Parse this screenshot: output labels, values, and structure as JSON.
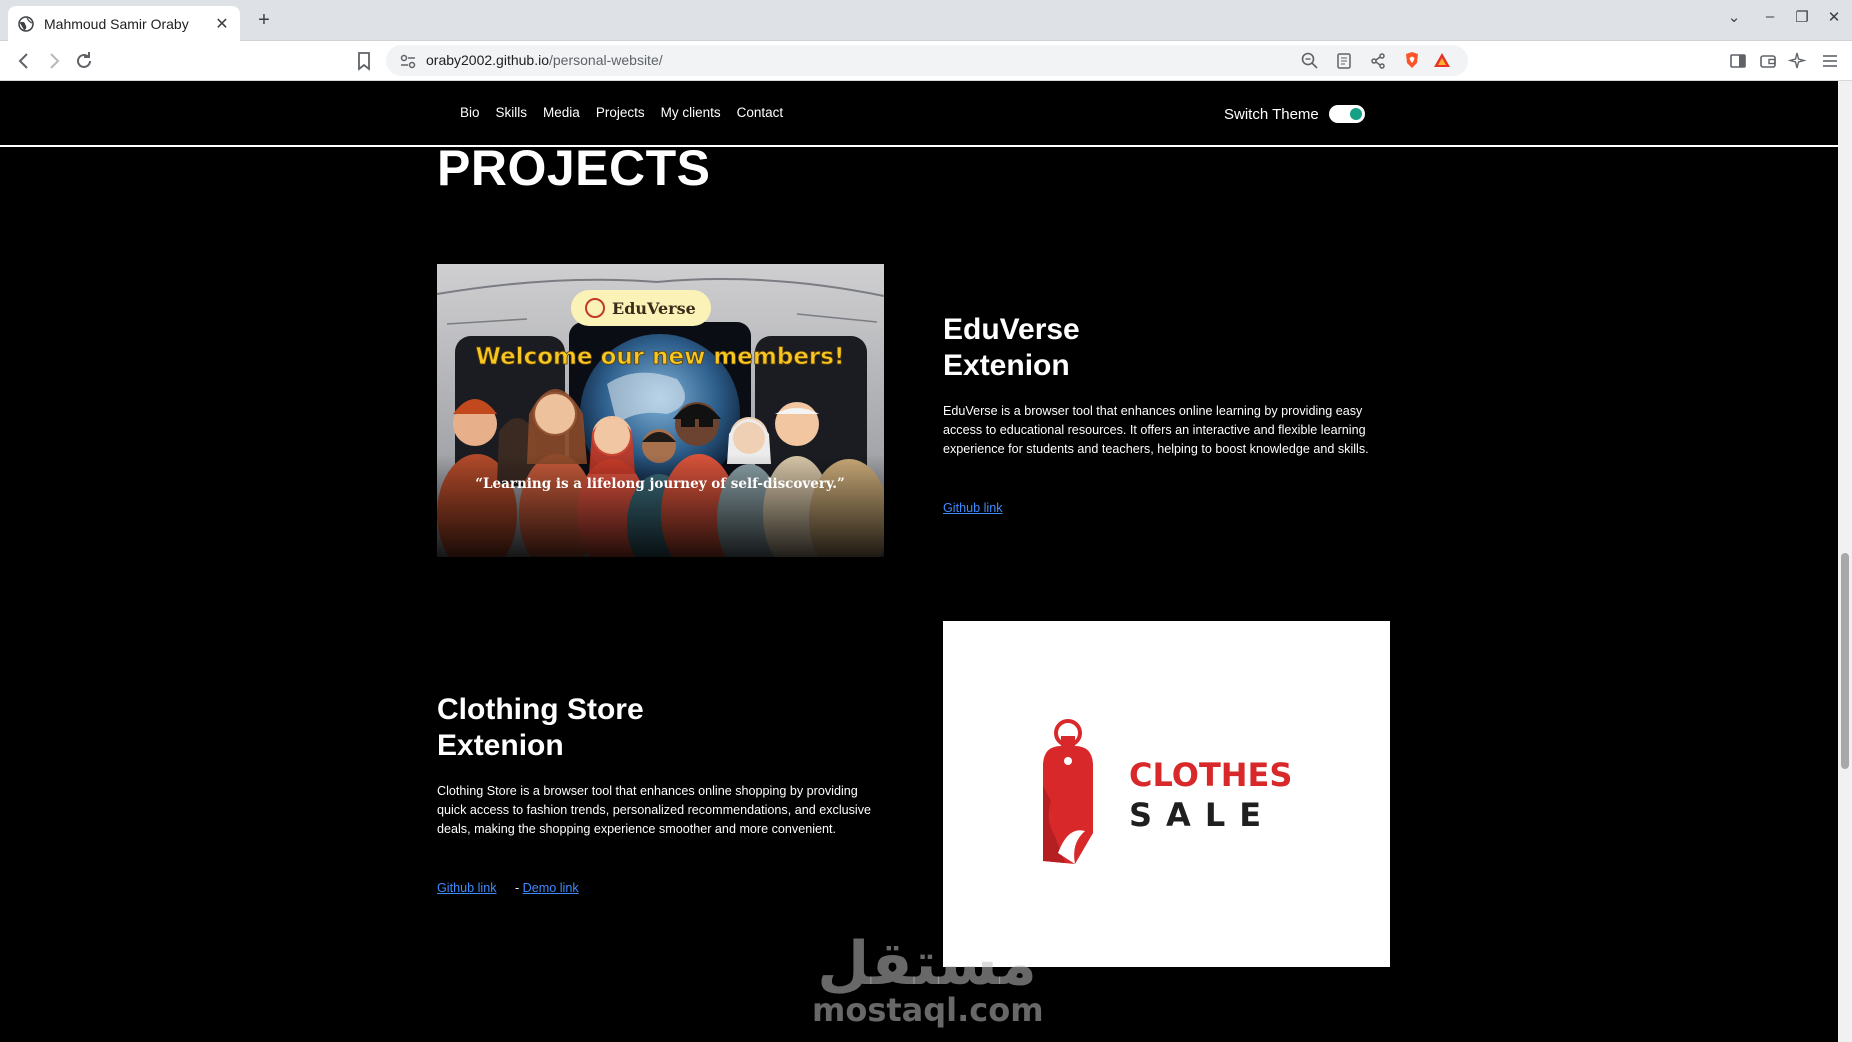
{
  "browser": {
    "tab_title": "Mahmoud Samir Oraby",
    "url_host": "oraby2002.github.io",
    "url_path": "/personal-website/"
  },
  "site": {
    "nav": [
      "Bio",
      "Skills",
      "Media",
      "Projects",
      "My clients",
      "Contact"
    ],
    "theme_label": "Switch Theme",
    "theme_on": true
  },
  "projects": {
    "heading": "PROJECTS",
    "items": [
      {
        "title_line1": "EduVerse",
        "title_line2": "Extenion",
        "description": "EduVerse is a browser tool that enhances online learning by providing easy access to educational resources. It offers an interactive and flexible learning experience for students and teachers, helping to boost knowledge and skills.",
        "github_label": "Github link ",
        "image": {
          "badge": "EduVerse",
          "banner": "Welcome our new members!",
          "quote": "“Learning is a lifelong journey of self-discovery.”"
        }
      },
      {
        "title_line1": "Clothing Store",
        "title_line2": "Extenion",
        "description": "Clothing Store is a browser tool that enhances online shopping by providing quick access to fashion trends, personalized recommendations, and exclusive deals, making the shopping experience smoother and more convenient.",
        "github_label": "Github link",
        "separator": "- ",
        "demo_label": "Demo link",
        "image": {
          "word1": "CLOTHES",
          "word2": "SALE"
        }
      }
    ]
  },
  "watermark": {
    "arabic": "مستقل",
    "latin": "mostaql.com"
  },
  "colors": {
    "accent_toggle": "#16a085",
    "link": "#3d8bfd",
    "brand_red": "#d8282a"
  }
}
